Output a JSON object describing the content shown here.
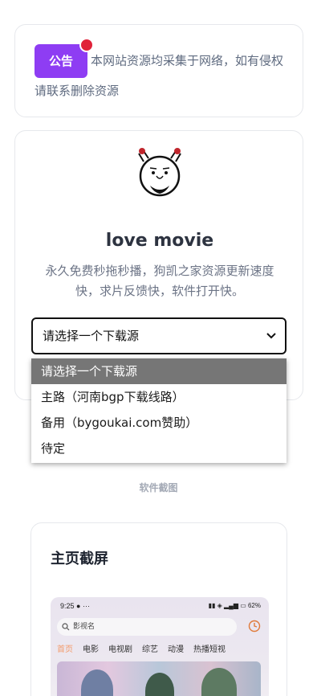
{
  "notice": {
    "badge": "公告",
    "text": "本网站资源均采集于网络，如有侵权请联系删除资源"
  },
  "profile": {
    "title": "love movie",
    "description": "永久免费秒拖秒播，狗凯之家资源更新速度快，求片反馈快，软件打开快。"
  },
  "download_select": {
    "value": "请选择一个下载源",
    "options": [
      "请选择一个下载源",
      "主路（河南bgp下载线路）",
      "备用（bygoukai.com赞助）",
      "待定"
    ]
  },
  "screenshots": {
    "section_label": "软件截图",
    "card_title": "主页截屏",
    "phone": {
      "time": "9:25",
      "status_right": "62%",
      "search_placeholder": "影视名",
      "tabs": [
        "首页",
        "电影",
        "电视剧",
        "综艺",
        "动漫",
        "热播短视"
      ]
    }
  },
  "colors": {
    "badge": "#8e3df3",
    "dot": "#e0223a",
    "active_tab": "#f39b6b"
  }
}
